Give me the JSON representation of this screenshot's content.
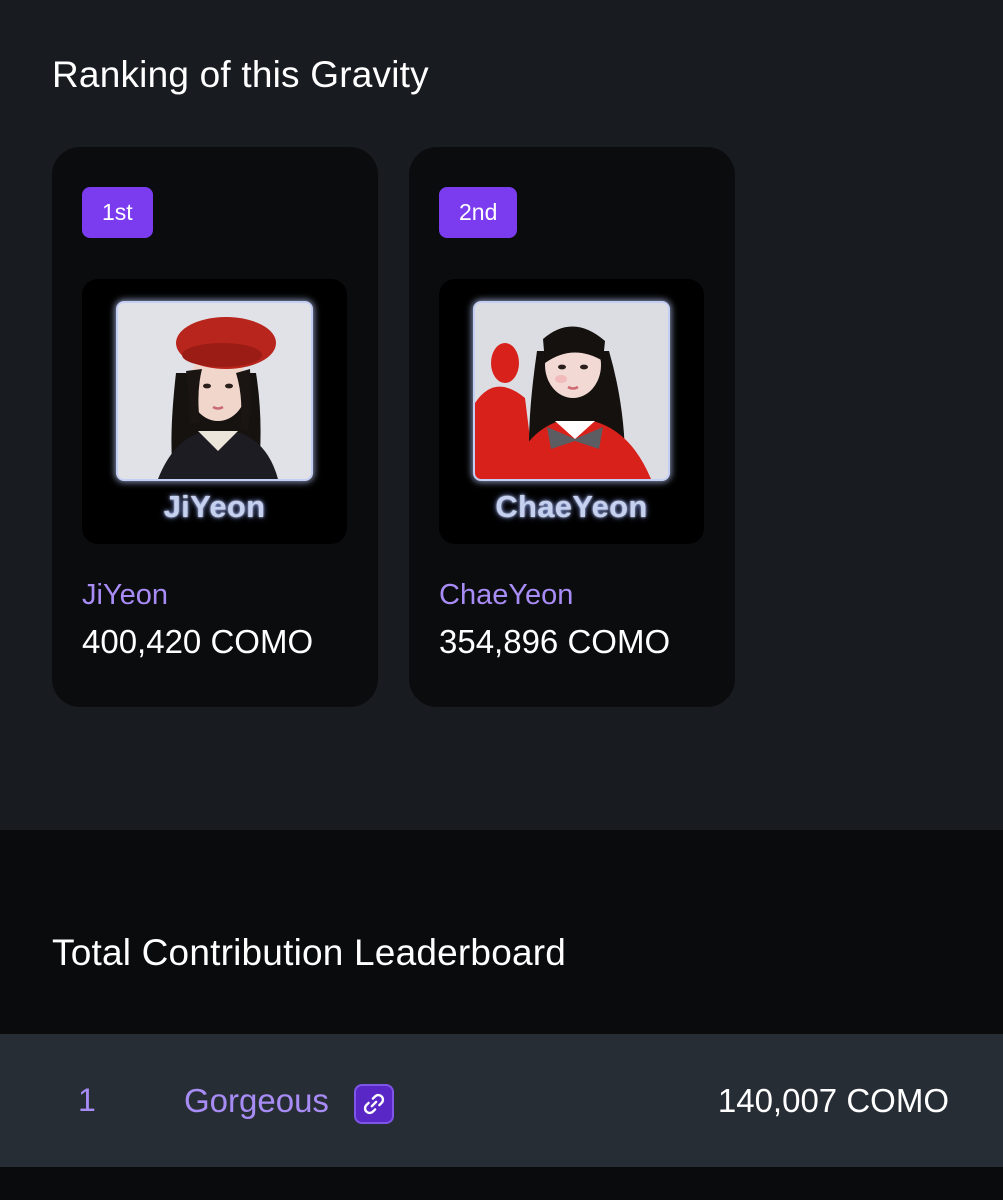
{
  "ranking": {
    "title": "Ranking of this Gravity",
    "cards": [
      {
        "rank": "1st",
        "caption": "JiYeon",
        "name": "JiYeon",
        "como": "400,420 COMO"
      },
      {
        "rank": "2nd",
        "caption": "ChaeYeon",
        "name": "ChaeYeon",
        "como": "354,896 COMO"
      }
    ]
  },
  "leaderboard": {
    "title": "Total Contribution Leaderboard",
    "rows": [
      {
        "rank": "1",
        "name": "Gorgeous",
        "como": "140,007 COMO",
        "icon": "link-icon"
      }
    ]
  },
  "colors": {
    "background": "#181b20",
    "leaderboard_background": "#0a0b0c",
    "card": "#0b0c0e",
    "accent_purple": "#7b3cf0",
    "name_purple": "#a88cf5",
    "row_background": "#272d35"
  }
}
